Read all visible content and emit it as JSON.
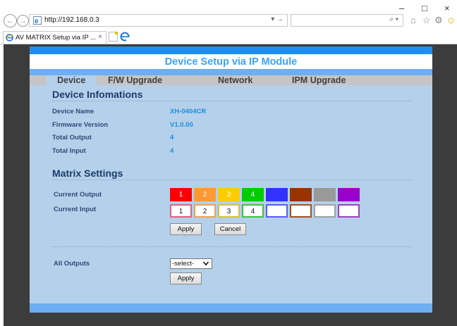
{
  "browser": {
    "url": "http://192.168.0.3",
    "tab_title": "AV MATRIX Setup via IP ...",
    "tab_close": "×",
    "go_icon": "→",
    "dropdown_icon": "▾",
    "search_icon": "⌕",
    "win_min": "–",
    "win_max": "□",
    "win_close": "×",
    "back_icon": "←",
    "forward_icon": "→",
    "home_icon": "⌂",
    "star_icon": "☆",
    "gear_icon": "⚙",
    "smiley_icon": "☺"
  },
  "page": {
    "title": "Device Setup via IP Module",
    "menu": [
      "Device",
      "F/W Upgrade",
      "Network",
      "IPM Upgrade"
    ],
    "device_info": {
      "title": "Device Infomations",
      "rows": [
        {
          "label": "Device Name",
          "value": "XH-0404CR"
        },
        {
          "label": "Firmware Version",
          "value": "V1.0.00"
        },
        {
          "label": "Total Output",
          "value": "4"
        },
        {
          "label": "Total Input",
          "value": "4"
        }
      ]
    },
    "matrix": {
      "title": "Matrix Settings",
      "output_label": "Current Output",
      "input_label": "Current Input",
      "outputs": [
        {
          "label": "1",
          "color": "#ff0000"
        },
        {
          "label": "2",
          "color": "#ff9933"
        },
        {
          "label": "3",
          "color": "#ffcc00"
        },
        {
          "label": "4",
          "color": "#00cc00"
        },
        {
          "label": "",
          "color": "#3333ff"
        },
        {
          "label": "",
          "color": "#993300"
        },
        {
          "label": "",
          "color": "#999999"
        },
        {
          "label": "",
          "color": "#9900cc"
        }
      ],
      "inputs": [
        {
          "value": "1",
          "border": "#e06080"
        },
        {
          "value": "2",
          "border": "#f0a050"
        },
        {
          "value": "3",
          "border": "#d8c040"
        },
        {
          "value": "4",
          "border": "#40c040"
        },
        {
          "value": "",
          "border": "#5a5aff"
        },
        {
          "value": "",
          "border": "#a05020"
        },
        {
          "value": "",
          "border": "#a0a0a0"
        },
        {
          "value": "",
          "border": "#a040c0"
        }
      ],
      "apply_label": "Apply",
      "cancel_label": "Cancel"
    },
    "all_outputs": {
      "label": "All Outputs",
      "selected": "-select-",
      "apply_label": "Apply"
    }
  }
}
